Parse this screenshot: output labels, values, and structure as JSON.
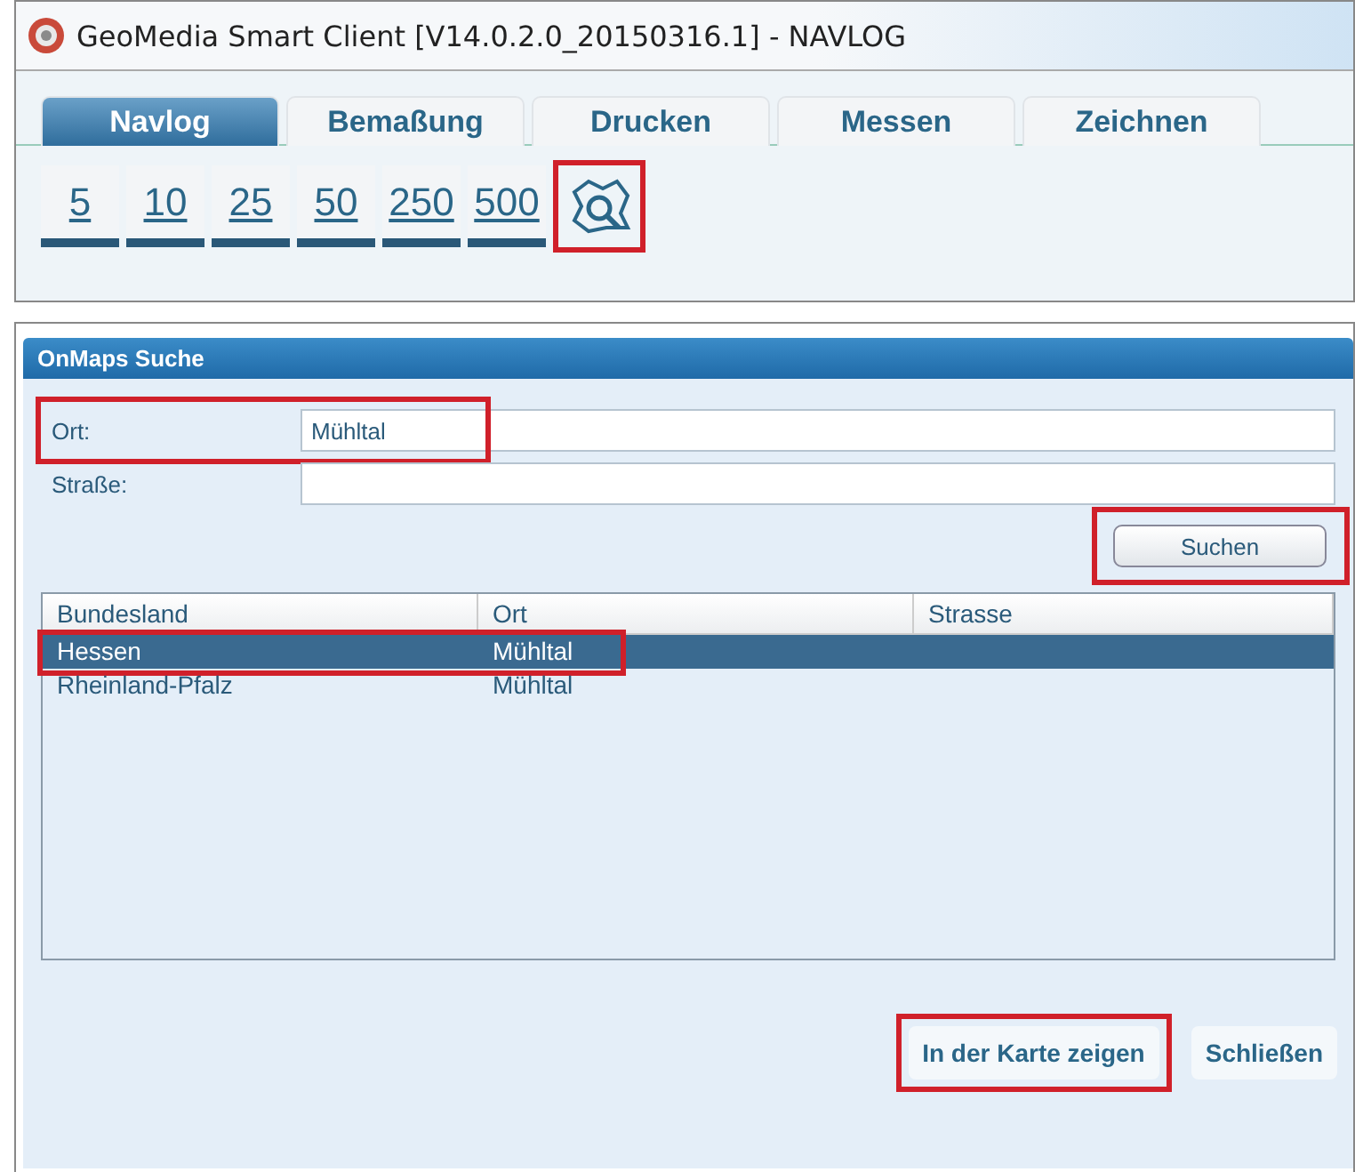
{
  "window": {
    "title": "GeoMedia Smart Client  [V14.0.2.0_20150316.1] - NAVLOG"
  },
  "tabs": [
    {
      "label": "Navlog",
      "selected": true
    },
    {
      "label": "Bemaßung",
      "selected": false
    },
    {
      "label": "Drucken",
      "selected": false
    },
    {
      "label": "Messen",
      "selected": false
    },
    {
      "label": "Zeichnen",
      "selected": false
    }
  ],
  "scale_buttons": [
    {
      "label": "5"
    },
    {
      "label": "10"
    },
    {
      "label": "25"
    },
    {
      "label": "50"
    },
    {
      "label": "250"
    },
    {
      "label": "500"
    }
  ],
  "search_tool": {
    "highlighted": true
  },
  "dialog": {
    "title": "OnMaps Suche",
    "fields": [
      {
        "label": "Ort:",
        "value": "Mühltal",
        "highlighted": true
      },
      {
        "label": "Straße:",
        "highlighted": false
      }
    ],
    "search_button": {
      "label": "Suchen",
      "highlighted": true
    },
    "table": {
      "columns": [
        "Bundesland",
        "Ort",
        "Strasse"
      ],
      "rows": [
        {
          "cells": [
            "Hessen",
            "Mühltal"
          ],
          "selected": true,
          "highlighted": true
        },
        {
          "cells": [
            "Rheinland-Pfalz",
            "Mühltal"
          ],
          "selected": false,
          "highlighted": false
        }
      ]
    },
    "buttons": [
      {
        "label": "In der Karte zeigen",
        "highlighted": true
      },
      {
        "label": "Schließen"
      }
    ]
  }
}
